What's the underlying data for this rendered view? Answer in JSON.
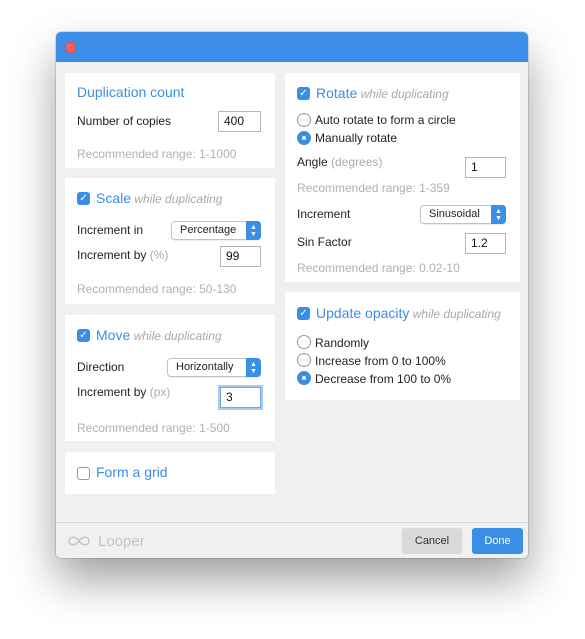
{
  "window": {
    "title": ""
  },
  "duplication": {
    "title": "Duplication count",
    "copies_label": "Number of copies",
    "copies_value": "400",
    "range": "Recommended range: 1-1000"
  },
  "scale": {
    "checked": true,
    "title": "Scale",
    "subtitle": "while duplicating",
    "increment_in_label": "Increment in",
    "increment_in_value": "Percentage",
    "increment_by_label": "Increment by",
    "increment_by_unit": "(%)",
    "increment_by_value": "99",
    "range": "Recommended range: 50-130"
  },
  "move": {
    "checked": true,
    "title": "Move",
    "subtitle": "while duplicating",
    "direction_label": "Direction",
    "direction_value": "Horizontally",
    "increment_by_label": "Increment by",
    "increment_by_unit": "(px)",
    "increment_by_value": "3",
    "range": "Recommended range: 1-500"
  },
  "grid": {
    "checked": false,
    "title": "Form a grid"
  },
  "rotate": {
    "checked": true,
    "title": "Rotate",
    "subtitle": "while duplicating",
    "options": [
      "Auto rotate to form a circle",
      "Manually rotate"
    ],
    "selected_option": "Manually rotate",
    "angle_label": "Angle",
    "angle_unit": "(degrees)",
    "angle_value": "1",
    "angle_range": "Recommended range: 1-359",
    "increment_label": "Increment",
    "increment_value": "Sinusoidal",
    "sin_factor_label": "Sin Factor",
    "sin_factor_value": "1.2",
    "sin_range": "Recommended range: 0.02-10"
  },
  "opacity": {
    "checked": true,
    "title": "Update opacity",
    "subtitle": "while duplicating",
    "options": [
      "Randomly",
      "Increase from 0 to 100%",
      "Decrease from 100 to 0%"
    ],
    "selected_option": "Decrease from 100 to 0%"
  },
  "footer": {
    "app_name": "Looper",
    "cancel_label": "Cancel",
    "done_label": "Done"
  },
  "colors": {
    "accent": "#3a8ee6",
    "titlebar": "#3d8ee8",
    "close": "#fc605c",
    "panel": "#ffffff",
    "background": "#f0f0f0"
  }
}
